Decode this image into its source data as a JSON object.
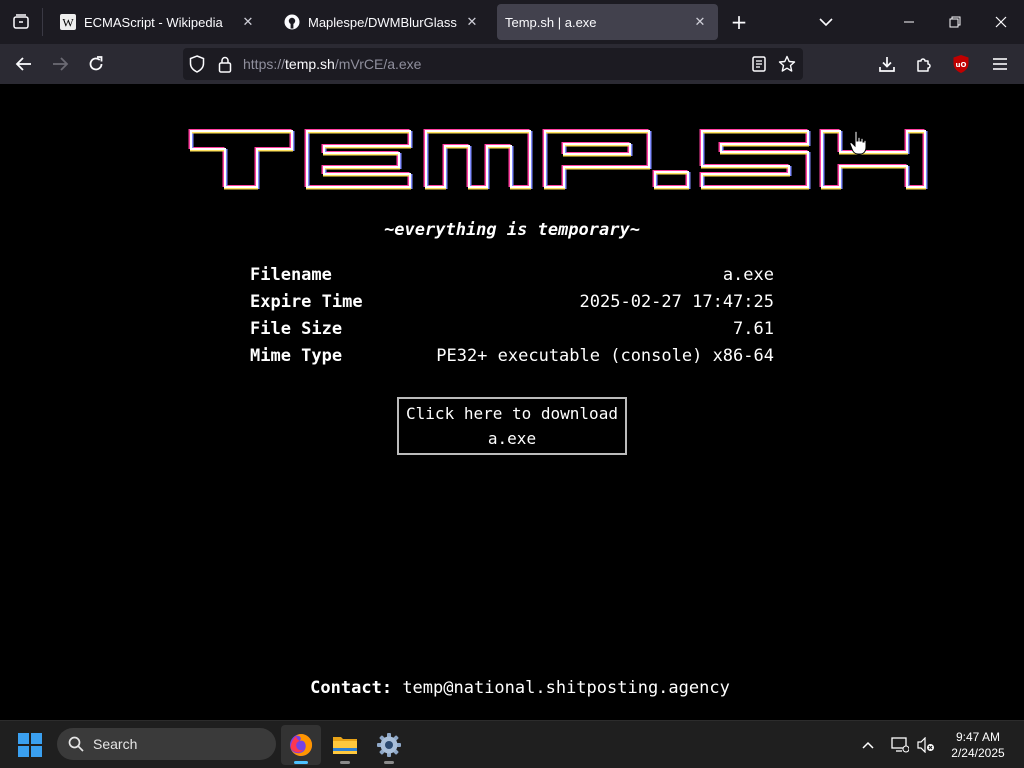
{
  "browser": {
    "tabs": [
      {
        "title": "ECMAScript - Wikipedia",
        "icon": "wikipedia-icon",
        "active": false
      },
      {
        "title": "Maplespe/DWMBlurGlass · Disc",
        "icon": "github-icon",
        "active": false
      },
      {
        "title": "Temp.sh | a.exe",
        "icon": "none",
        "active": true
      }
    ],
    "new_tab_label": "+",
    "url_prefix": "https://",
    "url_host": "temp.sh",
    "url_path": "/mVrCE/a.exe"
  },
  "page": {
    "logo_text": "TEMP.SH",
    "tagline": "~everything is temporary~",
    "info": [
      {
        "label": "Filename",
        "value": "a.exe"
      },
      {
        "label": "Expire Time",
        "value": "2025-02-27 17:47:25"
      },
      {
        "label": "File Size",
        "value": "7.61"
      },
      {
        "label": "Mime Type",
        "value": "PE32+ executable (console) x86-64"
      }
    ],
    "download": {
      "line1": "Click here to download",
      "line2": "a.exe"
    },
    "contact_label": "Contact:",
    "contact_email": "temp@national.shitposting.agency"
  },
  "taskbar": {
    "search_label": "Search",
    "time": "9:47 AM",
    "date": "2/24/2025"
  },
  "colors": {
    "tabstrip_bg": "#1c1b22",
    "toolbar_bg": "#2b2a33",
    "active_tab_bg": "#42414d",
    "page_bg": "#000000",
    "taskbar_bg": "#1f1f1f",
    "accent_blue": "#4cc2ff",
    "ublock_red": "#c00000"
  }
}
